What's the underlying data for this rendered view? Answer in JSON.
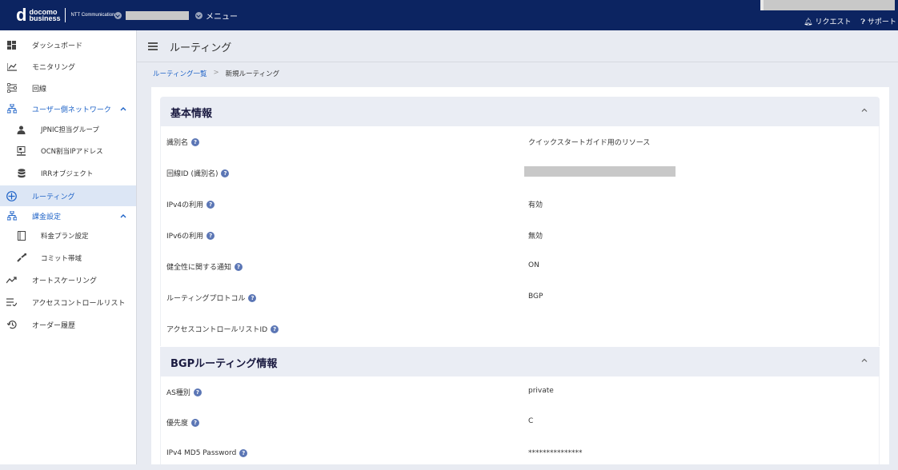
{
  "topbar": {
    "logo_main": "docomo",
    "logo_sub": "business",
    "logo_partner": "NTT Communications",
    "menu_label": "メニュー",
    "request_label": "リクエスト",
    "support_label": "サポート"
  },
  "sidebar": {
    "items": [
      {
        "label": "ダッシュボード",
        "icon": "dashboard-icon"
      },
      {
        "label": "モニタリング",
        "icon": "monitoring-icon"
      },
      {
        "label": "回線",
        "icon": "line-icon"
      },
      {
        "label": "ユーザー側ネットワーク",
        "icon": "network-icon",
        "expanded": true
      },
      {
        "label": "JPNIC担当グループ",
        "icon": "person-icon"
      },
      {
        "label": "OCN割当IPアドレス",
        "icon": "monitor-icon"
      },
      {
        "label": "IRRオブジェクト",
        "icon": "database-icon"
      },
      {
        "label": "ルーティング",
        "icon": "routing-icon",
        "active": true
      },
      {
        "label": "課金設定",
        "icon": "billing-icon",
        "expanded": true
      },
      {
        "label": "料金プラン設定",
        "icon": "plan-icon"
      },
      {
        "label": "コミット帯域",
        "icon": "commit-icon"
      },
      {
        "label": "オートスケーリング",
        "icon": "autoscaling-icon"
      },
      {
        "label": "アクセスコントロールリスト",
        "icon": "acl-icon"
      },
      {
        "label": "オーダー履歴",
        "icon": "history-icon"
      }
    ]
  },
  "header": {
    "title": "ルーティング"
  },
  "breadcrumb": {
    "parent": "ルーティング一覧",
    "separator": ">",
    "current": "新規ルーティング"
  },
  "basic": {
    "title": "基本情報",
    "rows": [
      {
        "label": "識別名",
        "value": "クイックスタートガイド用のリソース"
      },
      {
        "label": "回線ID (識別名)",
        "value": ""
      },
      {
        "label": "IPv4の利用",
        "value": "有効"
      },
      {
        "label": "IPv6の利用",
        "value": "無効"
      },
      {
        "label": "健全性に関する通知",
        "value": "ON"
      },
      {
        "label": "ルーティングプロトコル",
        "value": "BGP"
      },
      {
        "label": "アクセスコントロールリストID",
        "value": ""
      }
    ]
  },
  "bgp": {
    "title": "BGPルーティング情報",
    "rows": [
      {
        "label": "AS種別",
        "value": "private"
      },
      {
        "label": "優先度",
        "value": "C"
      },
      {
        "label": "IPv4 MD5 Password",
        "value": "***************"
      }
    ]
  },
  "help_glyph": "?",
  "collapse_glyph": "^",
  "colors": {
    "topbar": "#0c2461",
    "accent": "#1d62c7",
    "active_bg": "#dce6f5"
  }
}
